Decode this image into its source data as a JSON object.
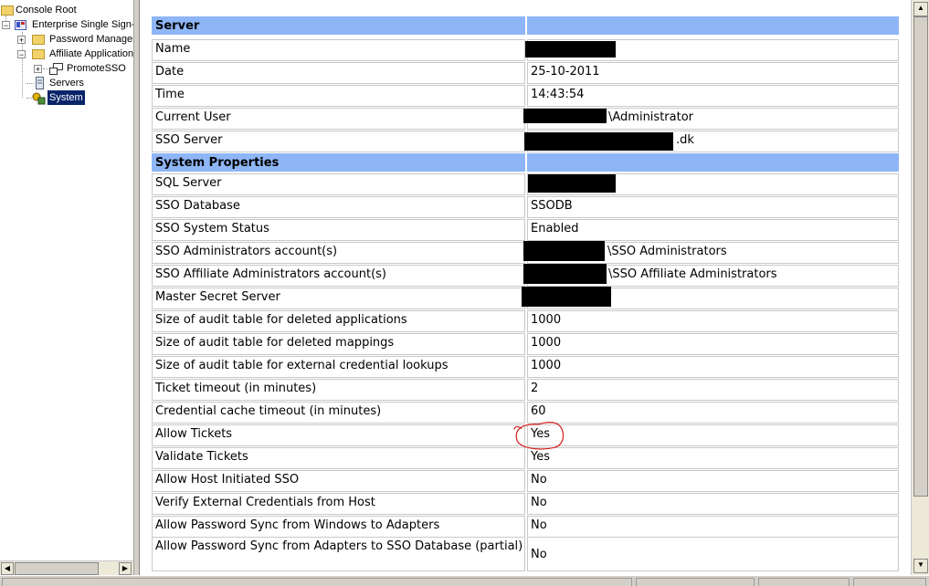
{
  "tree": {
    "items": [
      {
        "label": "Console Root"
      },
      {
        "label": "Enterprise Single Sign-C",
        "expander": "−"
      },
      {
        "label": "Password Manager",
        "expander": "+"
      },
      {
        "label": "Affiliate Application",
        "expander": "−"
      },
      {
        "label": "PromoteSSO",
        "expander": "+"
      },
      {
        "label": "Servers"
      },
      {
        "label": "System",
        "selected": true
      }
    ]
  },
  "table": {
    "rows": [
      {
        "type": "header",
        "label": "Server",
        "value": ""
      },
      {
        "label": "Name",
        "value": "",
        "redacted": true
      },
      {
        "label": "Date",
        "value": "25-10-2011"
      },
      {
        "label": "Time",
        "value": "14:43:54"
      },
      {
        "label": "Current User",
        "value": "\\Administrator",
        "redacted": true
      },
      {
        "label": "SSO Server",
        "value": ".dk",
        "redacted": true
      },
      {
        "type": "header",
        "label": "System Properties",
        "value": ""
      },
      {
        "label": "SQL Server",
        "value": "",
        "redacted": true
      },
      {
        "label": "SSO Database",
        "value": "SSODB"
      },
      {
        "label": "SSO System Status",
        "value": "Enabled"
      },
      {
        "label": "SSO Administrators account(s)",
        "value": "\\SSO Administrators",
        "redacted": true
      },
      {
        "label": "SSO Affiliate Administrators account(s)",
        "value": "\\SSO Affiliate Administrators",
        "redacted": true
      },
      {
        "label": "Master Secret Server",
        "value": "",
        "redacted": true
      },
      {
        "label": "Size of audit table for deleted applications",
        "value": "1000"
      },
      {
        "label": "Size of audit table for deleted mappings",
        "value": "1000"
      },
      {
        "label": "Size of audit table for external credential lookups",
        "value": "1000"
      },
      {
        "label": "Ticket timeout (in minutes)",
        "value": "2"
      },
      {
        "label": "Credential cache timeout (in minutes)",
        "value": "60"
      },
      {
        "label": "Allow Tickets",
        "value": "Yes",
        "circled": true
      },
      {
        "label": "Validate Tickets",
        "value": "Yes"
      },
      {
        "label": "Allow Host Initiated SSO",
        "value": "No"
      },
      {
        "label": "Verify External Credentials from Host",
        "value": "No"
      },
      {
        "label": "Allow Password Sync from Windows to Adapters",
        "value": "No"
      },
      {
        "label": "Allow Password Sync from Adapters to SSO Database (partial)",
        "value": "No"
      }
    ]
  },
  "colors": {
    "header_bg": "#8eb6f7",
    "selection_bg": "#0a246a",
    "annotation": "#d42020"
  },
  "icons": {
    "console_root": "folder-icon",
    "sso": "sso-snapin-icon",
    "password_manager": "folder-icon",
    "affiliate": "folder-icon",
    "promote": "application-icon",
    "servers": "servers-icon",
    "system": "system-icon"
  }
}
